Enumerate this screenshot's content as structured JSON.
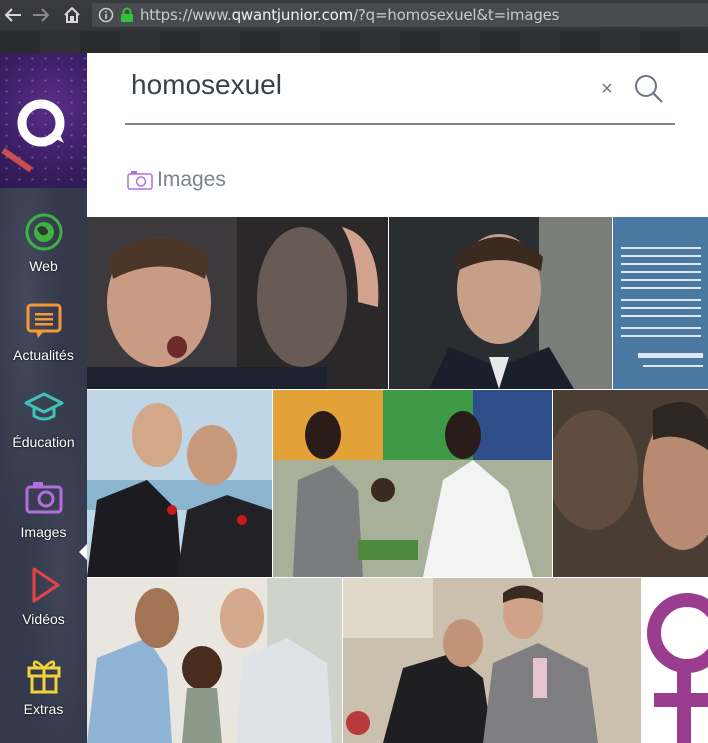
{
  "browser": {
    "url_scheme": "https://www.",
    "url_domain": "qwantjunior.com",
    "url_rest": "/?q=homosexuel&t=images"
  },
  "sidebar": {
    "items": [
      {
        "label": "Web",
        "icon": "web-globe-icon",
        "color": "#3fb043"
      },
      {
        "label": "Actualités",
        "icon": "news-icon",
        "color": "#f4983a"
      },
      {
        "label": "Éducation",
        "icon": "graduation-cap-icon",
        "color": "#3ec3b6"
      },
      {
        "label": "Images",
        "icon": "camera-icon",
        "color": "#b36fe0"
      },
      {
        "label": "Vidéos",
        "icon": "play-icon",
        "color": "#e84343"
      },
      {
        "label": "Extras",
        "icon": "gift-icon",
        "color": "#f4d23a"
      }
    ]
  },
  "search": {
    "query": "homosexuel",
    "clear_symbol": "×"
  },
  "results": {
    "section_label": "Images",
    "section_icon": "camera-icon",
    "accent": "#b36fe0"
  }
}
